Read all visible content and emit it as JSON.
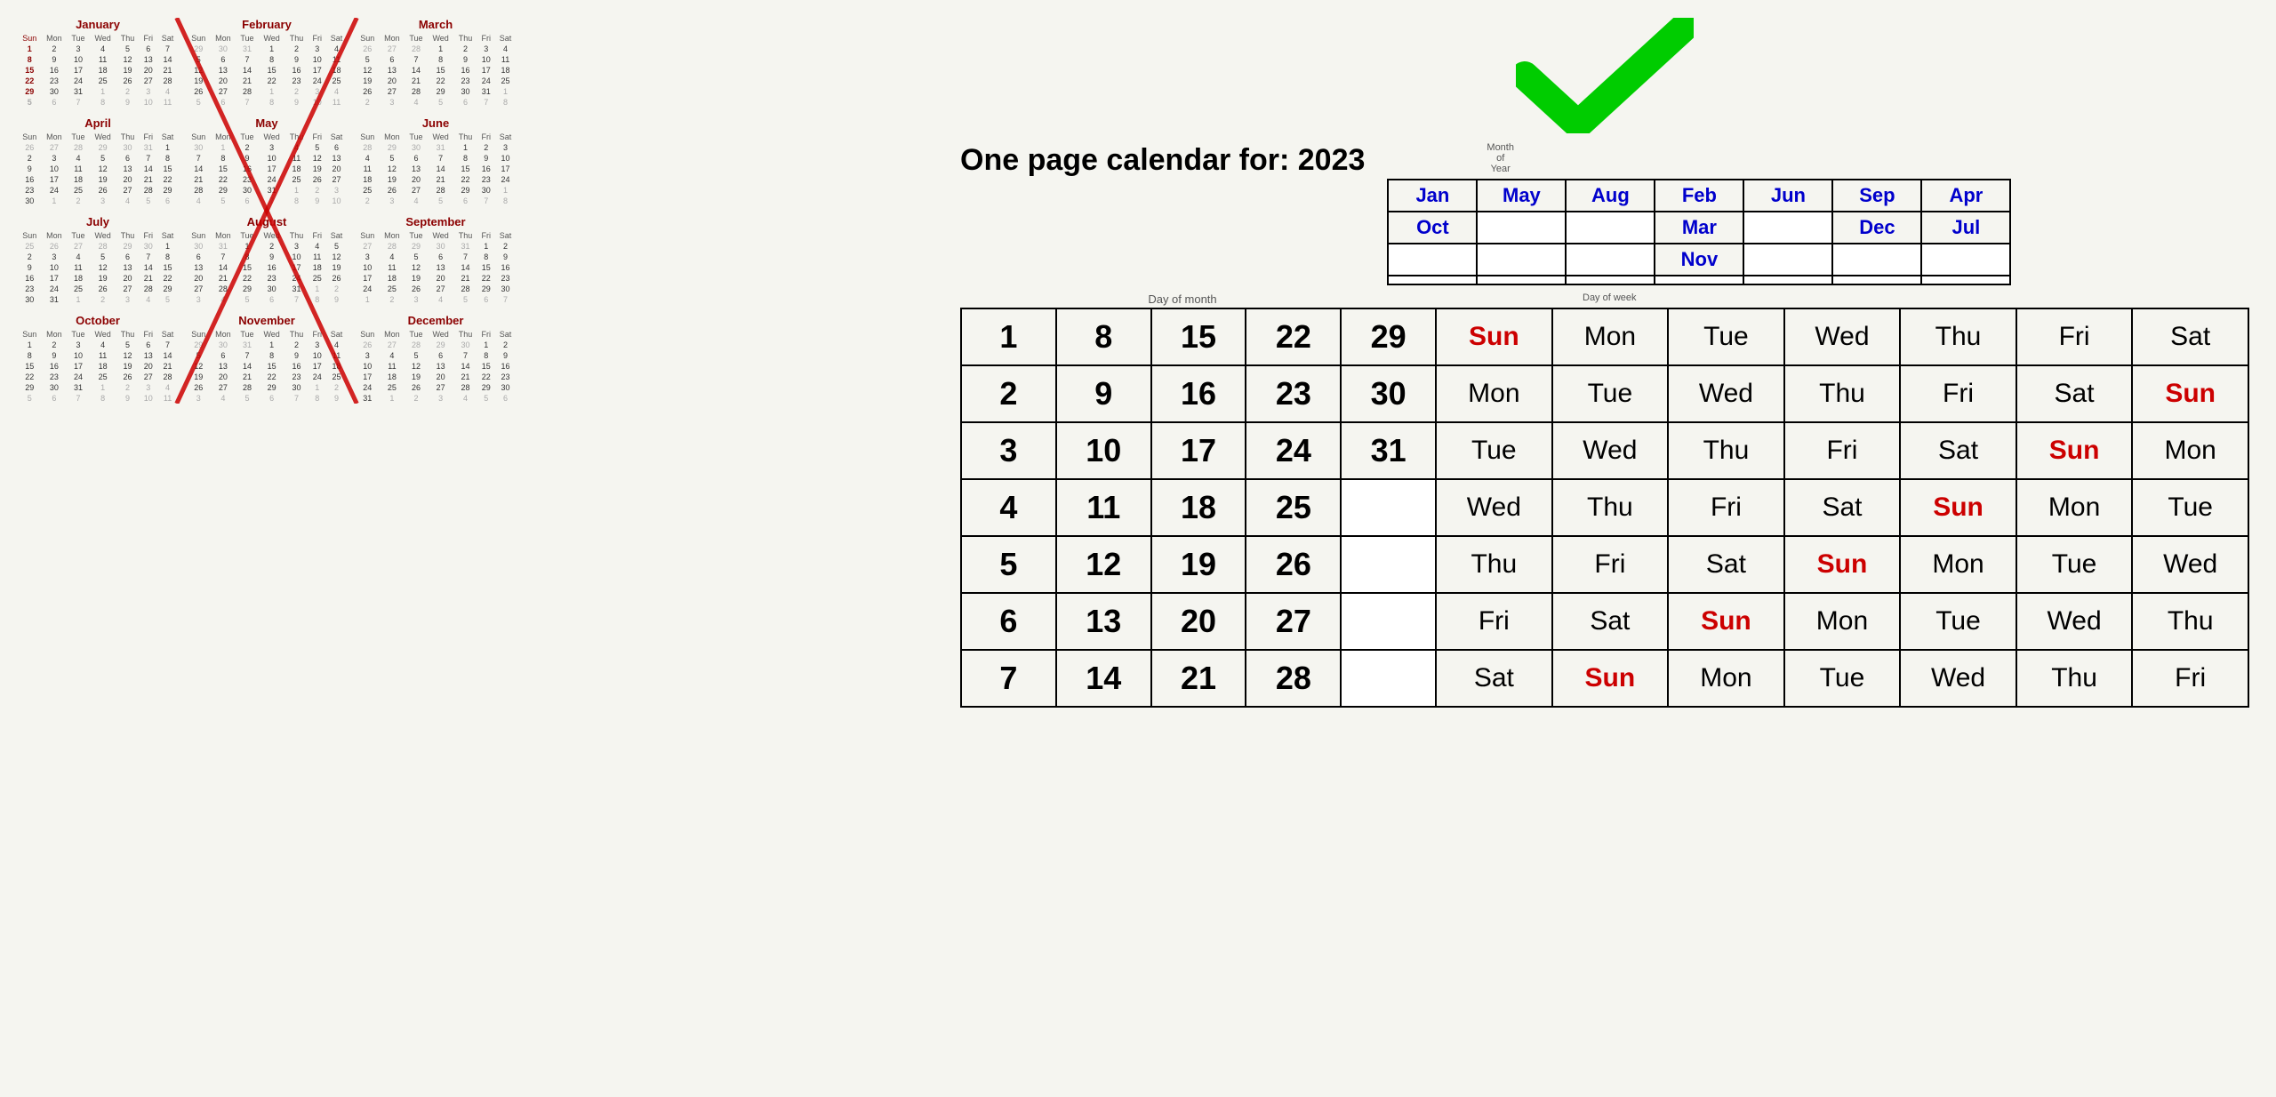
{
  "page": {
    "title": "One page calendar for: 2023"
  },
  "checkmark": {
    "color": "#00cc00"
  },
  "traditional_calendar": {
    "months": [
      {
        "name": "January",
        "days": [
          [
            "",
            "",
            "",
            "",
            "",
            "",
            ""
          ],
          [
            "Sun",
            "Mon",
            "Tue",
            "Wed",
            "Thu",
            "Fri",
            "Sat"
          ],
          [
            "1",
            "2",
            "3",
            "4",
            "5",
            "6",
            "7"
          ],
          [
            "8",
            "9",
            "10",
            "11",
            "12",
            "13",
            "14"
          ],
          [
            "15",
            "16",
            "17",
            "18",
            "19",
            "20",
            "21"
          ],
          [
            "22",
            "23",
            "24",
            "25",
            "26",
            "27",
            "28"
          ],
          [
            "29",
            "30",
            "31",
            "1",
            "2",
            "3",
            "4"
          ],
          [
            "5",
            "6",
            "7",
            "8",
            "9",
            "10",
            "11"
          ]
        ]
      }
    ]
  },
  "month_map": {
    "col1": [
      "Jan",
      "Oct"
    ],
    "col2": [
      "May",
      ""
    ],
    "col3": [
      "Aug",
      ""
    ],
    "col4": [
      "Feb",
      "Mar",
      "Nov"
    ],
    "col5": [
      "Jun",
      ""
    ],
    "col6": [
      "Sep",
      "Dec"
    ],
    "col7": [
      "Apr",
      "Jul"
    ]
  },
  "labels": {
    "month_of_year": "Month\nof\nYear",
    "day_of_month": "Day of month",
    "day_of_week": "Day of week"
  },
  "main_table": {
    "day_nums": [
      {
        "row": 1,
        "d1": "1",
        "d2": "8",
        "d3": "15",
        "d4": "22",
        "d5": "29"
      },
      {
        "row": 2,
        "d1": "2",
        "d2": "9",
        "d3": "16",
        "d4": "23",
        "d5": "30"
      },
      {
        "row": 3,
        "d1": "3",
        "d2": "10",
        "d3": "17",
        "d4": "24",
        "d5": "31"
      },
      {
        "row": 4,
        "d1": "4",
        "d2": "11",
        "d3": "18",
        "d4": "25",
        "d5": ""
      },
      {
        "row": 5,
        "d1": "5",
        "d2": "12",
        "d3": "19",
        "d4": "26",
        "d5": ""
      },
      {
        "row": 6,
        "d1": "6",
        "d2": "13",
        "d3": "20",
        "d4": "27",
        "d5": ""
      },
      {
        "row": 7,
        "d1": "7",
        "d2": "14",
        "d3": "21",
        "d4": "28",
        "d5": ""
      }
    ],
    "dow_cols": [
      {
        "label": "col1",
        "rows": [
          "Sun",
          "Mon",
          "Tue",
          "Wed",
          "Thu",
          "Fri",
          "Sat"
        ]
      },
      {
        "label": "col2",
        "rows": [
          "Mon",
          "Tue",
          "Wed",
          "Thu",
          "Fri",
          "Sat",
          "Sun"
        ]
      },
      {
        "label": "col3",
        "rows": [
          "Tue",
          "Wed",
          "Thu",
          "Fri",
          "Sat",
          "Sun",
          "Mon"
        ]
      },
      {
        "label": "col4",
        "rows": [
          "Wed",
          "Thu",
          "Fri",
          "Sat",
          "Sun",
          "Mon",
          "Tue"
        ]
      },
      {
        "label": "col5",
        "rows": [
          "Thu",
          "Fri",
          "Sat",
          "Sun",
          "Mon",
          "Tue",
          "Wed"
        ]
      },
      {
        "label": "col6",
        "rows": [
          "Fri",
          "Sat",
          "Sun",
          "Mon",
          "Tue",
          "Wed",
          "Thu"
        ]
      },
      {
        "label": "col7",
        "rows": [
          "Sat",
          "Sun",
          "Mon",
          "Tue",
          "Wed",
          "Thu",
          "Fri"
        ]
      }
    ]
  }
}
